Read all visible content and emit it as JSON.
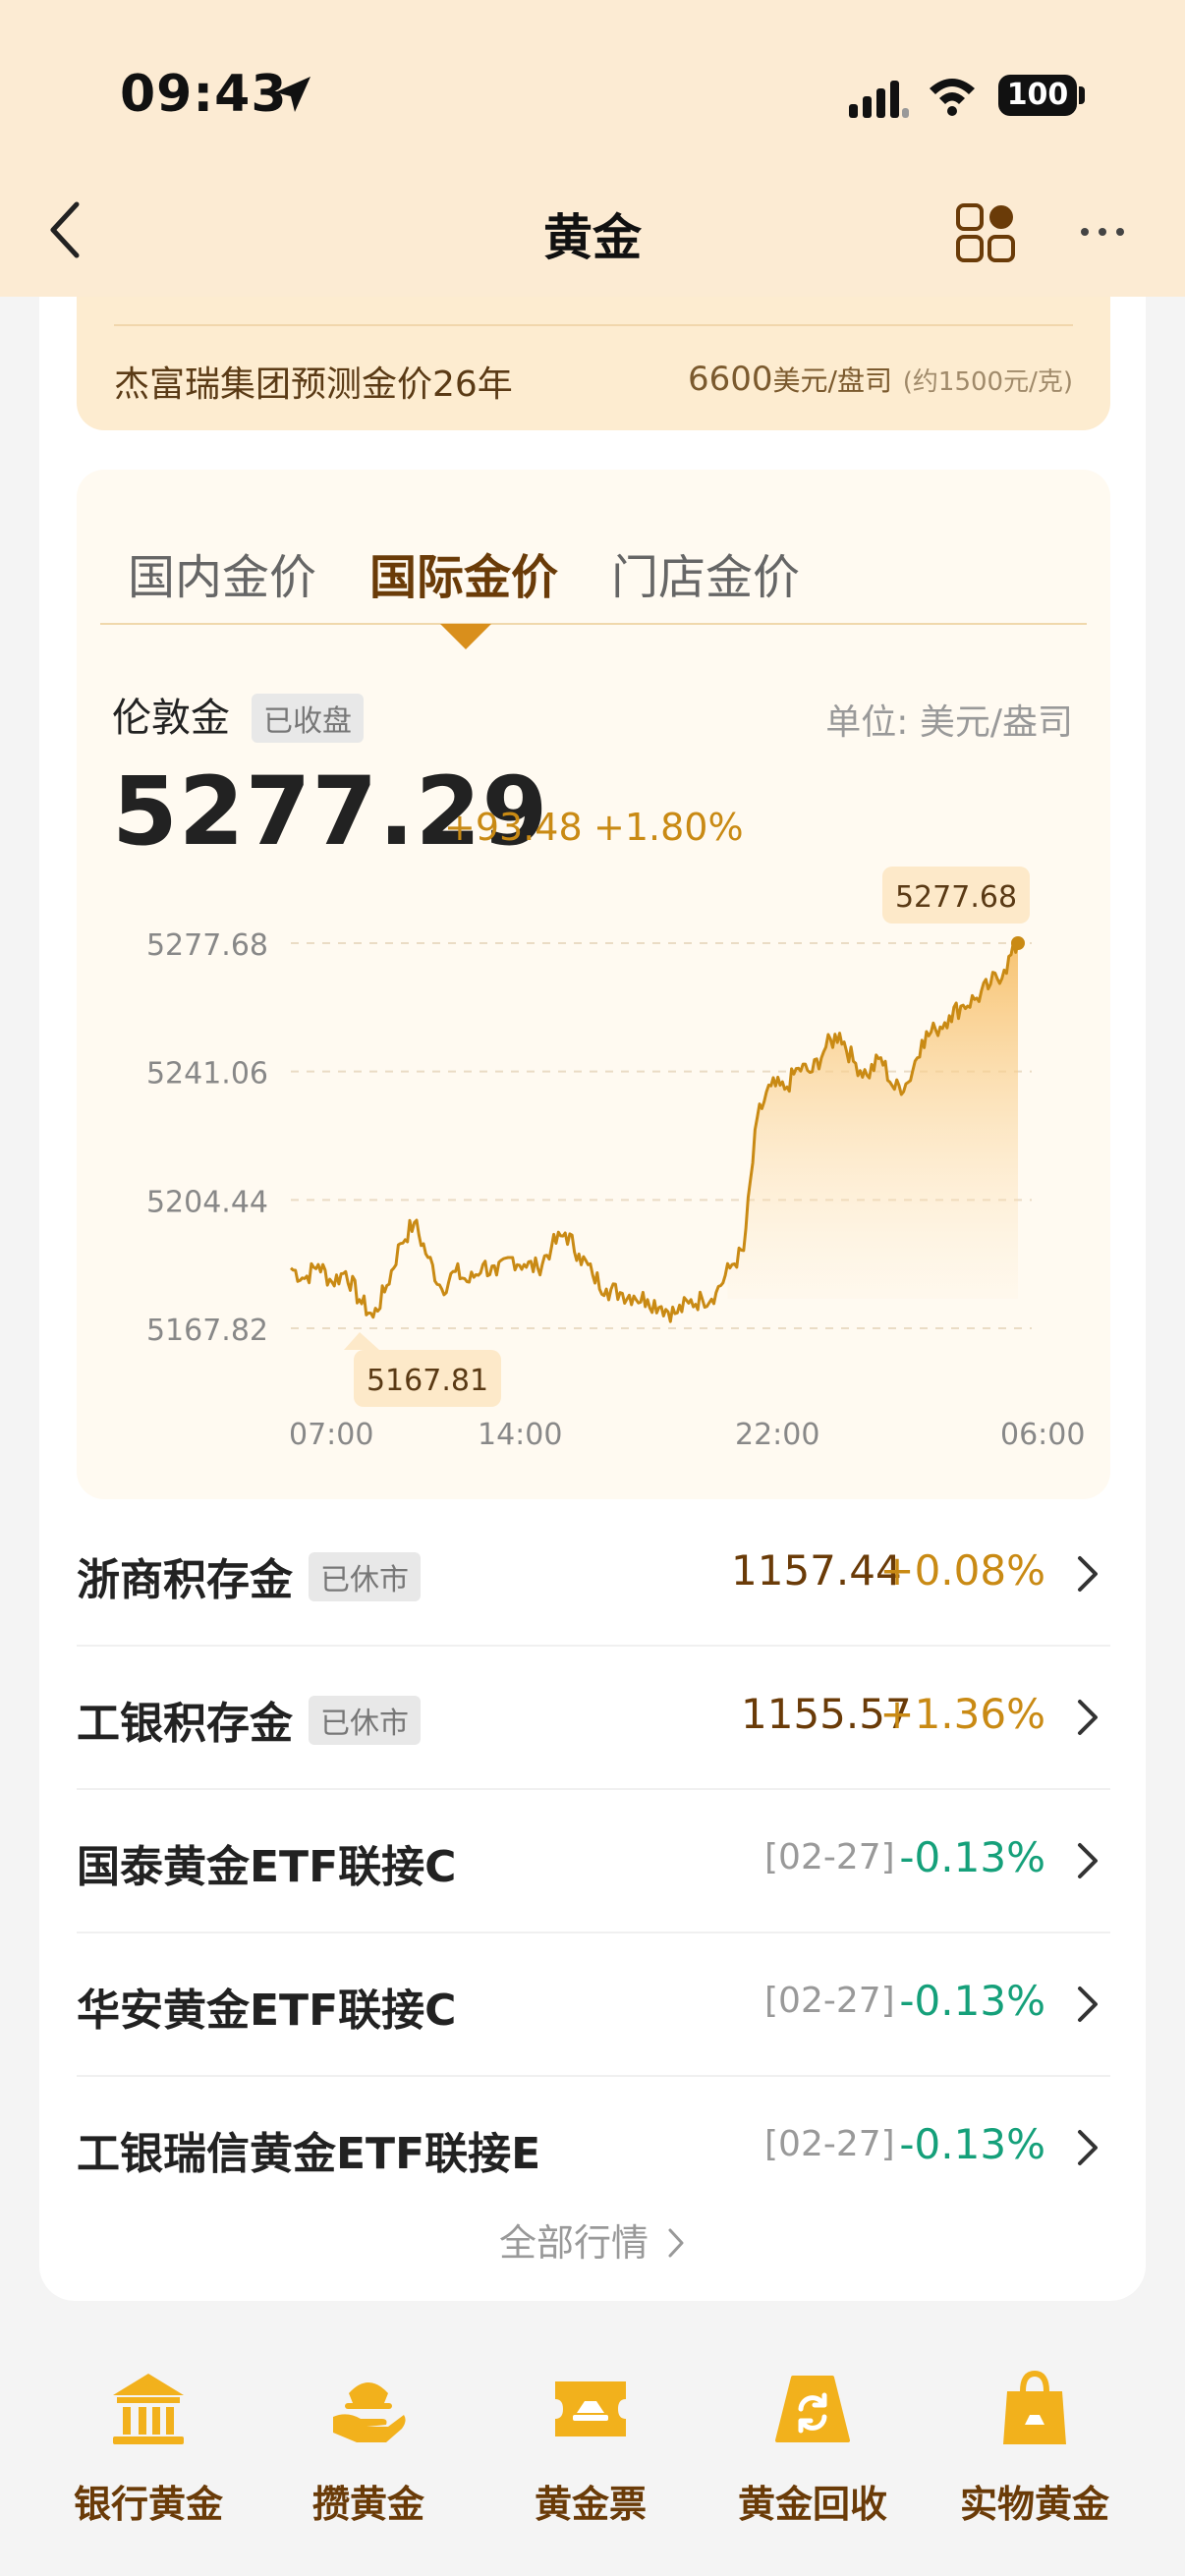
{
  "status_bar": {
    "time": "09:43",
    "battery": "100"
  },
  "nav": {
    "title": "黄金"
  },
  "forecast": {
    "text": "杰富瑞集团预测金价26年",
    "price": "6600",
    "unit": "美元/盘司",
    "approx": "(约1500元/克)"
  },
  "tabs": [
    {
      "label": "国内金价",
      "active": false
    },
    {
      "label": "国际金价",
      "active": true
    },
    {
      "label": "门店金价",
      "active": false
    }
  ],
  "quote": {
    "name": "伦敦金",
    "status": "已收盘",
    "unit_label": "单位:  美元/盎司",
    "price": "5277.29",
    "change": "+93.48",
    "change_pct": "+1.80%"
  },
  "chart_data": {
    "type": "line",
    "x_ticks": [
      "07:00",
      "14:00",
      "22:00",
      "06:00"
    ],
    "y_ticks": [
      "5277.68",
      "5241.06",
      "5204.44",
      "5167.82"
    ],
    "ylim": [
      5167.82,
      5277.68
    ],
    "max_label": "5277.68",
    "min_label": "5167.81",
    "x": [
      "06:00",
      "06:30",
      "07:00",
      "07:30",
      "08:00",
      "08:30",
      "09:00",
      "09:30",
      "10:00",
      "10:30",
      "11:00",
      "11:30",
      "12:00",
      "12:30",
      "13:00",
      "13:30",
      "14:00",
      "14:30",
      "15:00",
      "15:30",
      "16:00",
      "16:30",
      "17:00",
      "17:30",
      "18:00",
      "18:30",
      "19:00",
      "19:30",
      "20:00",
      "20:30",
      "21:00",
      "21:30",
      "22:00",
      "22:30",
      "23:00",
      "23:30",
      "00:00",
      "00:30",
      "01:00",
      "01:30",
      "02:00",
      "02:30",
      "03:00",
      "03:30",
      "04:00",
      "04:30",
      "05:00",
      "05:30",
      "06:00",
      "06:30"
    ],
    "values": [
      5185,
      5182,
      5186,
      5181,
      5184,
      5176,
      5171,
      5180,
      5192,
      5198,
      5188,
      5179,
      5184,
      5181,
      5186,
      5183,
      5188,
      5186,
      5185,
      5191,
      5195,
      5189,
      5183,
      5179,
      5178,
      5177,
      5176,
      5174,
      5172,
      5175,
      5176,
      5178,
      5185,
      5190,
      5228,
      5237,
      5236,
      5242,
      5241,
      5248,
      5252,
      5244,
      5240,
      5245,
      5236,
      5238,
      5250,
      5253,
      5257,
      5260,
      5262,
      5266,
      5270,
      5277.68
    ],
    "line_color": "#c98a14"
  },
  "rows": [
    {
      "name": "浙商积存金",
      "badge": "已休市",
      "price": "1157.44",
      "pct": "+0.08%",
      "dir": "up"
    },
    {
      "name": "工银积存金",
      "badge": "已休市",
      "price": "1155.57",
      "pct": "+1.36%",
      "dir": "up"
    },
    {
      "name": "国泰黄金ETF联接C",
      "date": "[02-27]",
      "pct": "-0.13%",
      "dir": "down"
    },
    {
      "name": "华安黄金ETF联接C",
      "date": "[02-27]",
      "pct": "-0.13%",
      "dir": "down"
    },
    {
      "name": "工银瑞信黄金ETF联接E",
      "date": "[02-27]",
      "pct": "-0.13%",
      "dir": "down"
    }
  ],
  "all_link": "全部行情",
  "dock": [
    {
      "label": "银行黄金",
      "icon": "bank-icon"
    },
    {
      "label": "攒黄金",
      "icon": "save-gold-icon"
    },
    {
      "label": "黄金票",
      "icon": "ticket-icon"
    },
    {
      "label": "黄金回收",
      "icon": "recycle-icon"
    },
    {
      "label": "实物黄金",
      "icon": "shopping-bag-icon"
    }
  ]
}
